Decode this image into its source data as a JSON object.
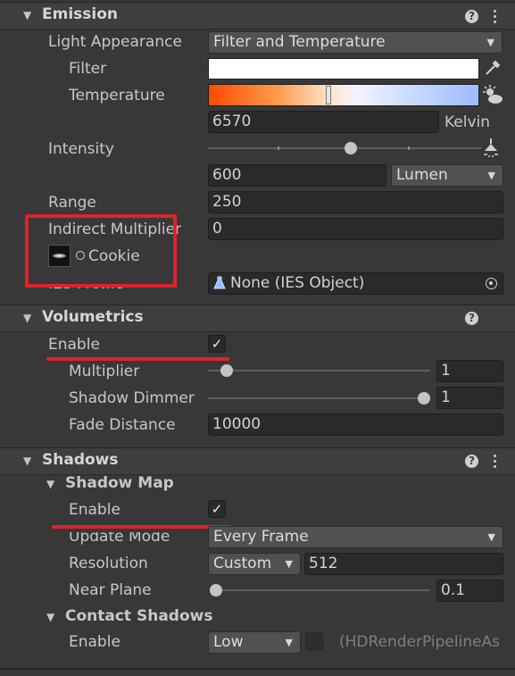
{
  "emission": {
    "title": "Emission",
    "light_appearance": {
      "label": "Light Appearance",
      "value": "Filter and Temperature"
    },
    "filter": {
      "label": "Filter",
      "color": "#ffffff"
    },
    "temperature": {
      "label": "Temperature",
      "value": "6570",
      "unit": "Kelvin"
    },
    "intensity": {
      "label": "Intensity",
      "value": "600",
      "unit": "Lumen",
      "slider_fraction": 0.5
    },
    "range": {
      "label": "Range",
      "value": "250"
    },
    "indirect_multiplier": {
      "label": "Indirect Multiplier",
      "value": "0"
    },
    "cookie": {
      "label": "Cookie"
    },
    "ies_profile": {
      "label": "IES Profile",
      "value": "None (IES Object)"
    }
  },
  "volumetrics": {
    "title": "Volumetrics",
    "enable": {
      "label": "Enable",
      "checked": true
    },
    "multiplier": {
      "label": "Multiplier",
      "value": "1",
      "slider_fraction": 0.08
    },
    "shadow_dimmer": {
      "label": "Shadow Dimmer",
      "value": "1",
      "slider_fraction": 1.0
    },
    "fade_distance": {
      "label": "Fade Distance",
      "value": "10000"
    }
  },
  "shadows": {
    "title": "Shadows",
    "shadow_map": {
      "title": "Shadow Map",
      "enable": {
        "label": "Enable",
        "checked": true
      },
      "update_mode": {
        "label": "Update Mode",
        "value": "Every Frame"
      },
      "resolution": {
        "label": "Resolution",
        "mode": "Custom",
        "value": "512"
      },
      "near_plane": {
        "label": "Near Plane",
        "value": "0.1",
        "slider_fraction": 0.0
      }
    },
    "contact_shadows": {
      "title": "Contact Shadows",
      "enable": {
        "label": "Enable",
        "value": "Low",
        "override_text": "(HDRenderPipelineAs"
      }
    }
  },
  "icons": {
    "help": "?",
    "checkmark": "✓",
    "dropdown_arrow": "▼",
    "foldout": "▼"
  },
  "colors": {
    "annotation_red": "#e0222a"
  }
}
